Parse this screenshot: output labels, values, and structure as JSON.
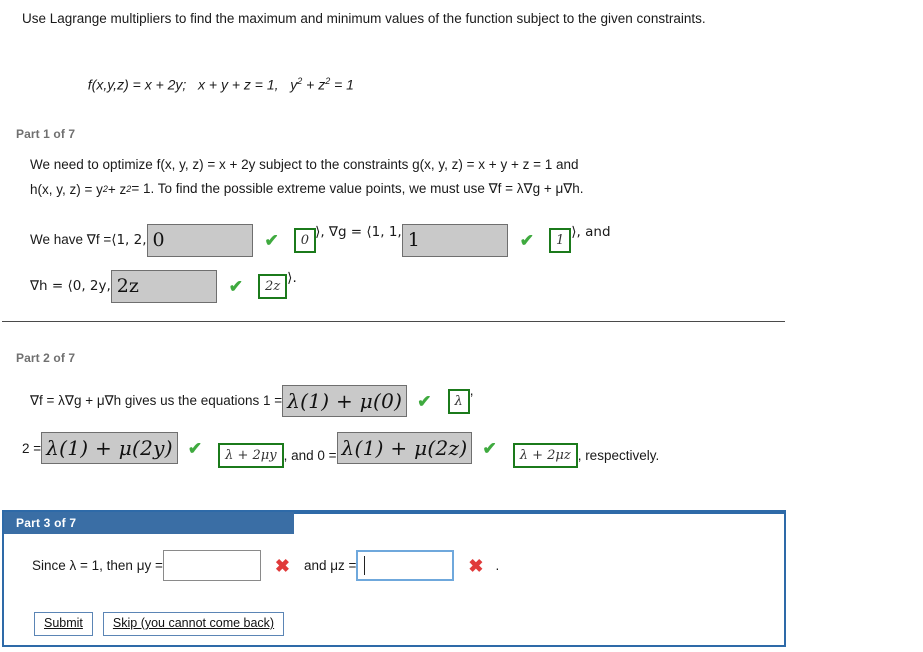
{
  "prompt": {
    "text": "Use Lagrange multipliers to find the maximum and minimum values of the function subject to the given constraints.",
    "formula_f": "f(x,y,z) = x + 2y;",
    "formula_g": "x + y + z = 1,",
    "formula_h_base": "y",
    "formula_h_rest": " + z",
    "formula_h_tail": " = 1",
    "sup2": "2"
  },
  "part1": {
    "label": "Part 1 of 7",
    "sentence_a": "We need to optimize  f(x, y, z) = x + 2y  subject to the constraints  g(x, y, z) = x + y + z = 1  and",
    "sentence_b_pre": "h(x, y, z) = y",
    "sentence_b_mid": " + z",
    "sentence_b_post": " = 1.  To find the possible extreme value points, we must use  ∇f = λ∇g + μ∇h.",
    "we_have": "We have  ∇f = ",
    "grad_f_prefix": "⟨1, 2, ",
    "grad_f_answer": "0",
    "grad_f_correct": "0",
    "grad_g_prefix": "⟩,  ∇g = ⟨1, 1, ",
    "grad_g_answer": "1",
    "grad_g_correct": "1",
    "and_word": "⟩,  and",
    "grad_h_prefix": "∇h = ⟨0, 2y, ",
    "grad_h_answer": "2z",
    "grad_h_correct": "2z",
    "grad_h_suffix": "⟩."
  },
  "part2": {
    "label": "Part 2 of 7",
    "lead": "∇f = λ∇g + μ∇h  gives us the equations 1 = ",
    "eq1_answer": "λ(1) + μ(0)",
    "eq1_correct": "λ",
    "eq1_suffix": ",",
    "eq2_prefix": "2 = ",
    "eq2_answer": "λ(1) + μ(2y)",
    "eq2_correct": "λ + 2μy",
    "eq2_suffix": ", and 0 = ",
    "eq3_answer": "λ(1) + μ(2z)",
    "eq3_correct": "λ + 2μz",
    "eq3_suffix": ", respectively."
  },
  "part3": {
    "label": "Part 3 of 7",
    "sentence_prefix": "Since λ = 1, then μy = ",
    "input1_value": "",
    "mark1": "✖",
    "sentence_mid": "and μz = ",
    "input2_value": "",
    "mark2": "✖",
    "sentence_end": ".",
    "submit_label": "Submit",
    "skip_label": "Skip (you cannot come back)"
  },
  "marks": {
    "check": "✔",
    "cross": "✖"
  },
  "colors": {
    "header_blue": "#3a6ea5",
    "panel_border": "#2e6aa8",
    "check_green": "#3faa3f",
    "cross_red": "#e03a3a",
    "chip_green": "#1b7a1b",
    "answer_grey": "#c9c9c9"
  }
}
